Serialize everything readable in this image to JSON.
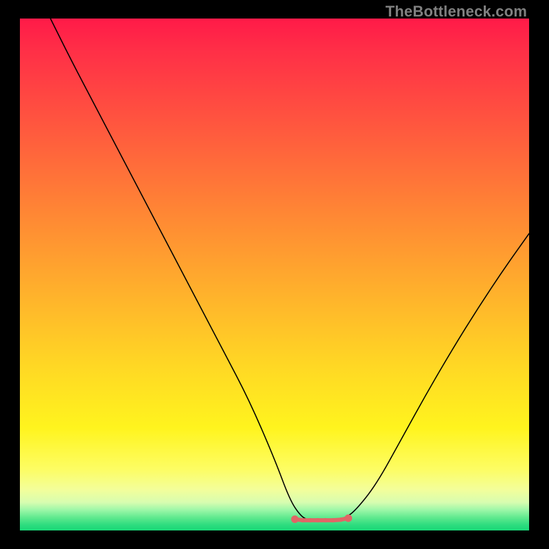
{
  "watermark": "TheBottleneck.com",
  "colors": {
    "black": "#000000",
    "curve": "#000000",
    "marker": "#e06666",
    "gradient_top": "#ff1a48",
    "gradient_mid": "#fff41e",
    "gradient_bottom": "#1ad877"
  },
  "chart_data": {
    "type": "line",
    "title": "",
    "xlabel": "",
    "ylabel": "",
    "xlim": [
      0,
      100
    ],
    "ylim": [
      0,
      100
    ],
    "grid": false,
    "legend": false,
    "annotations": [],
    "series": [
      {
        "name": "bottleneck-curve",
        "x": [
          6,
          10,
          15,
          20,
          25,
          30,
          35,
          40,
          45,
          50,
          53,
          55,
          56.5,
          58,
          60,
          62,
          64,
          66,
          70,
          75,
          80,
          85,
          90,
          95,
          100
        ],
        "y": [
          100,
          92,
          82.5,
          73,
          63.5,
          54,
          44.5,
          35,
          25.5,
          14,
          6,
          3,
          2,
          2,
          2,
          2,
          2.5,
          4,
          9,
          18,
          27,
          35.5,
          43.5,
          51,
          58
        ]
      }
    ],
    "flat_bottom_markers": {
      "name": "optimum-range",
      "x": [
        54,
        55.5,
        57,
        58.5,
        60,
        61.5,
        63,
        64.5
      ],
      "y": [
        2.2,
        2,
        2,
        2,
        2,
        2,
        2.1,
        2.4
      ]
    }
  }
}
